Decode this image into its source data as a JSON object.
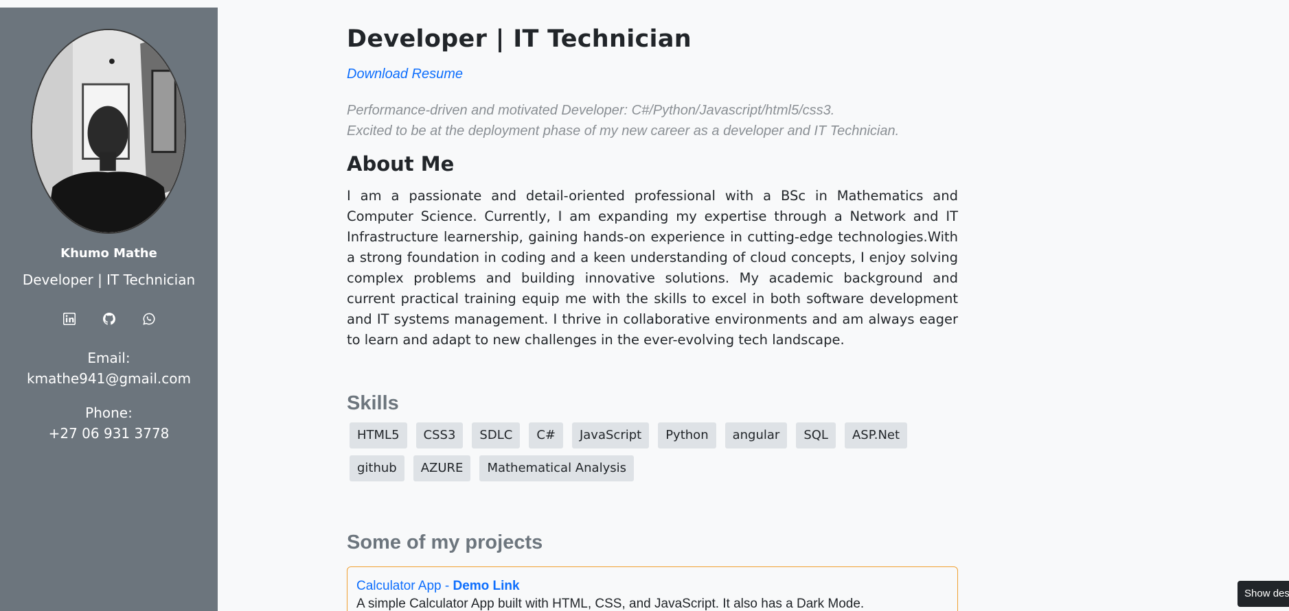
{
  "sidebar": {
    "name": "Khumo Mathe",
    "title": "Developer | IT Technician",
    "social": [
      "linkedin-icon",
      "github-icon",
      "whatsapp-icon"
    ],
    "email_label": "Email:",
    "email": "kmathe941@gmail.com",
    "phone_label": "Phone:",
    "phone": "+27 06 931 3778"
  },
  "main": {
    "role": "Developer | IT Technician",
    "download": "Download Resume",
    "tagline_1": "Performance-driven and motivated Developer: C#/Python/Javascript/html5/css3.",
    "tagline_2": "Excited to be at the deployment phase of my new career as a developer and IT Technician.",
    "about_heading": "About Me",
    "about_text": "I am a passionate and detail-oriented professional with a BSc in Mathematics and Computer Science. Currently, I am expanding my expertise through a Network and IT Infrastructure learnership, gaining hands-on experience in cutting-edge technologies.With a strong foundation in coding and a keen understanding of cloud concepts, I enjoy solving complex problems and building innovative solutions. My academic background and current practical training equip me with the skills to excel in both software development and IT systems management. I thrive in collaborative environments and am always eager to learn and adapt to new challenges in the ever-evolving tech landscape.",
    "skills_heading": "Skills",
    "skills": [
      "HTML5",
      "CSS3",
      "SDLC",
      "C#",
      "JavaScript",
      "Python",
      "angular",
      "SQL",
      "ASP.Net",
      "github",
      "AZURE",
      "Mathematical Analysis"
    ],
    "projects_heading": "Some of my projects",
    "projects": [
      {
        "name": "Calculator App",
        "separator": " - ",
        "link": "Demo Link",
        "description": "A simple Calculator App built with HTML, CSS, and JavaScript. It also has a Dark Mode."
      }
    ]
  },
  "toast": "Show des",
  "colors": {
    "sidebar": "#6c757d",
    "link": "#0d6efd",
    "project_border": "#f0a030",
    "skill_bg": "#dee2e6"
  }
}
